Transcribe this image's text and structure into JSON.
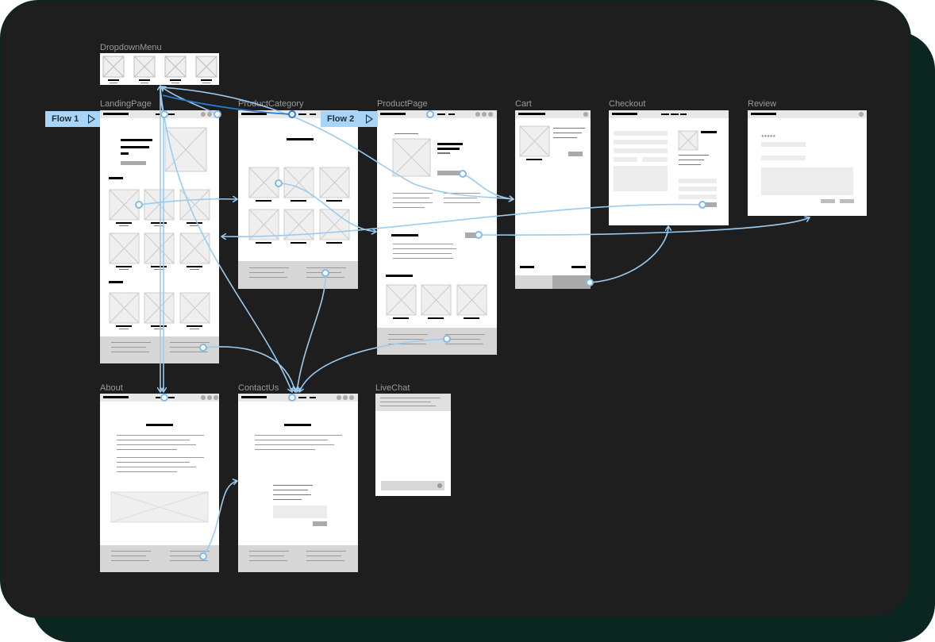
{
  "canvas": {
    "background": "#1e1e1e",
    "frame_border": "#0b2620",
    "connector_color": "#9ccbf0"
  },
  "frames": {
    "dropdown_menu": "DropdownMenu",
    "landing_page": "LandingPage",
    "product_category": "ProductCategory",
    "product_page": "ProductPage",
    "cart": "Cart",
    "checkout": "Checkout",
    "review": "Review",
    "about": "About",
    "contact_us": "ContactUs",
    "live_chat": "LiveChat"
  },
  "flows": [
    {
      "label": "Flow 1",
      "icon": "play-icon"
    },
    {
      "label": "Flow 2",
      "icon": "play-icon"
    }
  ],
  "review": {
    "rating_stars": "●●●●●"
  }
}
